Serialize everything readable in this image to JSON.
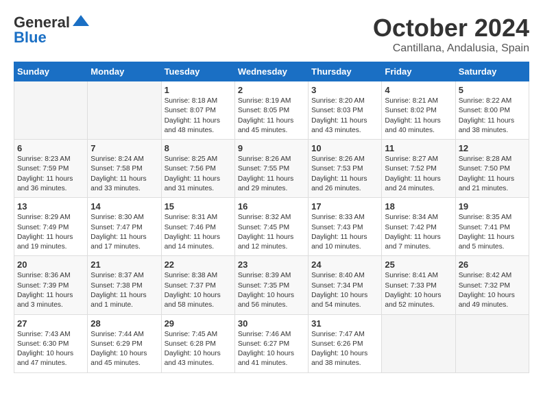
{
  "header": {
    "logo": {
      "general": "General",
      "blue": "Blue"
    },
    "title": "October 2024",
    "location": "Cantillana, Andalusia, Spain"
  },
  "calendar": {
    "days_of_week": [
      "Sunday",
      "Monday",
      "Tuesday",
      "Wednesday",
      "Thursday",
      "Friday",
      "Saturday"
    ],
    "weeks": [
      [
        {
          "day": "",
          "content": ""
        },
        {
          "day": "",
          "content": ""
        },
        {
          "day": "1",
          "content": "Sunrise: 8:18 AM\nSunset: 8:07 PM\nDaylight: 11 hours and 48 minutes."
        },
        {
          "day": "2",
          "content": "Sunrise: 8:19 AM\nSunset: 8:05 PM\nDaylight: 11 hours and 45 minutes."
        },
        {
          "day": "3",
          "content": "Sunrise: 8:20 AM\nSunset: 8:03 PM\nDaylight: 11 hours and 43 minutes."
        },
        {
          "day": "4",
          "content": "Sunrise: 8:21 AM\nSunset: 8:02 PM\nDaylight: 11 hours and 40 minutes."
        },
        {
          "day": "5",
          "content": "Sunrise: 8:22 AM\nSunset: 8:00 PM\nDaylight: 11 hours and 38 minutes."
        }
      ],
      [
        {
          "day": "6",
          "content": "Sunrise: 8:23 AM\nSunset: 7:59 PM\nDaylight: 11 hours and 36 minutes."
        },
        {
          "day": "7",
          "content": "Sunrise: 8:24 AM\nSunset: 7:58 PM\nDaylight: 11 hours and 33 minutes."
        },
        {
          "day": "8",
          "content": "Sunrise: 8:25 AM\nSunset: 7:56 PM\nDaylight: 11 hours and 31 minutes."
        },
        {
          "day": "9",
          "content": "Sunrise: 8:26 AM\nSunset: 7:55 PM\nDaylight: 11 hours and 29 minutes."
        },
        {
          "day": "10",
          "content": "Sunrise: 8:26 AM\nSunset: 7:53 PM\nDaylight: 11 hours and 26 minutes."
        },
        {
          "day": "11",
          "content": "Sunrise: 8:27 AM\nSunset: 7:52 PM\nDaylight: 11 hours and 24 minutes."
        },
        {
          "day": "12",
          "content": "Sunrise: 8:28 AM\nSunset: 7:50 PM\nDaylight: 11 hours and 21 minutes."
        }
      ],
      [
        {
          "day": "13",
          "content": "Sunrise: 8:29 AM\nSunset: 7:49 PM\nDaylight: 11 hours and 19 minutes."
        },
        {
          "day": "14",
          "content": "Sunrise: 8:30 AM\nSunset: 7:47 PM\nDaylight: 11 hours and 17 minutes."
        },
        {
          "day": "15",
          "content": "Sunrise: 8:31 AM\nSunset: 7:46 PM\nDaylight: 11 hours and 14 minutes."
        },
        {
          "day": "16",
          "content": "Sunrise: 8:32 AM\nSunset: 7:45 PM\nDaylight: 11 hours and 12 minutes."
        },
        {
          "day": "17",
          "content": "Sunrise: 8:33 AM\nSunset: 7:43 PM\nDaylight: 11 hours and 10 minutes."
        },
        {
          "day": "18",
          "content": "Sunrise: 8:34 AM\nSunset: 7:42 PM\nDaylight: 11 hours and 7 minutes."
        },
        {
          "day": "19",
          "content": "Sunrise: 8:35 AM\nSunset: 7:41 PM\nDaylight: 11 hours and 5 minutes."
        }
      ],
      [
        {
          "day": "20",
          "content": "Sunrise: 8:36 AM\nSunset: 7:39 PM\nDaylight: 11 hours and 3 minutes."
        },
        {
          "day": "21",
          "content": "Sunrise: 8:37 AM\nSunset: 7:38 PM\nDaylight: 11 hours and 1 minute."
        },
        {
          "day": "22",
          "content": "Sunrise: 8:38 AM\nSunset: 7:37 PM\nDaylight: 10 hours and 58 minutes."
        },
        {
          "day": "23",
          "content": "Sunrise: 8:39 AM\nSunset: 7:35 PM\nDaylight: 10 hours and 56 minutes."
        },
        {
          "day": "24",
          "content": "Sunrise: 8:40 AM\nSunset: 7:34 PM\nDaylight: 10 hours and 54 minutes."
        },
        {
          "day": "25",
          "content": "Sunrise: 8:41 AM\nSunset: 7:33 PM\nDaylight: 10 hours and 52 minutes."
        },
        {
          "day": "26",
          "content": "Sunrise: 8:42 AM\nSunset: 7:32 PM\nDaylight: 10 hours and 49 minutes."
        }
      ],
      [
        {
          "day": "27",
          "content": "Sunrise: 7:43 AM\nSunset: 6:30 PM\nDaylight: 10 hours and 47 minutes."
        },
        {
          "day": "28",
          "content": "Sunrise: 7:44 AM\nSunset: 6:29 PM\nDaylight: 10 hours and 45 minutes."
        },
        {
          "day": "29",
          "content": "Sunrise: 7:45 AM\nSunset: 6:28 PM\nDaylight: 10 hours and 43 minutes."
        },
        {
          "day": "30",
          "content": "Sunrise: 7:46 AM\nSunset: 6:27 PM\nDaylight: 10 hours and 41 minutes."
        },
        {
          "day": "31",
          "content": "Sunrise: 7:47 AM\nSunset: 6:26 PM\nDaylight: 10 hours and 38 minutes."
        },
        {
          "day": "",
          "content": ""
        },
        {
          "day": "",
          "content": ""
        }
      ]
    ]
  }
}
